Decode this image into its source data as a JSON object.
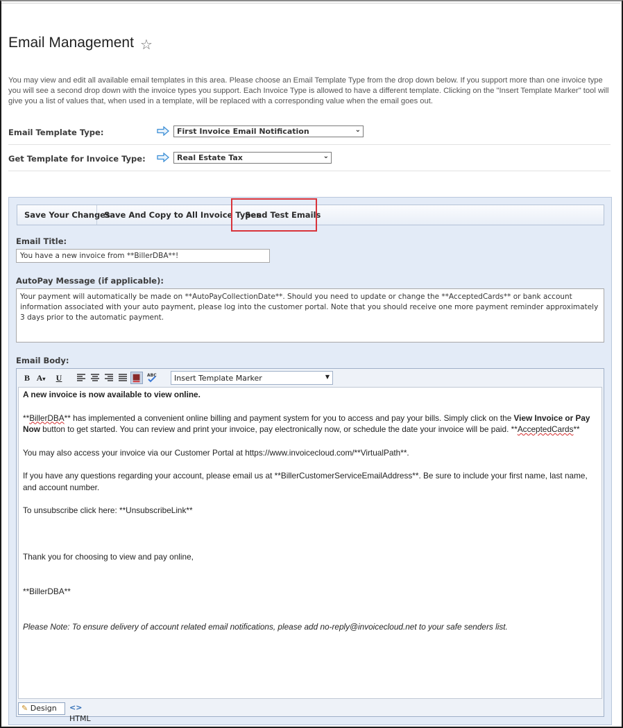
{
  "page": {
    "title": "Email Management",
    "favorite_icon": "star-icon",
    "intro": "You may view and edit all available email templates in this area. Please choose an Email Template Type from the drop down below. If you support more than one invoice type you will see a second drop down with the invoice types you support. Each Invoice Type is allowed to have a different template. Clicking on the \"Insert Template Marker\" tool will give you a list of values that, when used in a template, will be replaced with a corresponding value when the email goes out."
  },
  "fields": {
    "template_type_label": "Email Template Type:",
    "template_type_value": "First Invoice Email Notification",
    "invoice_type_label": "Get Template for Invoice Type:",
    "invoice_type_value": "Real Estate Tax"
  },
  "toolbar": {
    "save_label": "Save Your Changes",
    "save_copy_label": "Save And Copy to All Invoice Types",
    "send_test_label": "Send Test Emails",
    "highlight_color": "#d9333a"
  },
  "form": {
    "email_title_label": "Email Title:",
    "email_title_value": "You have a new invoice from **BillerDBA**!",
    "autopay_label": "AutoPay Message (if applicable):",
    "autopay_value": "Your payment will automatically be made on **AutoPayCollectionDate**. Should you need to update or change the **AcceptedCards** or bank account information associated with your auto payment, please log into the customer portal. Note that you should receive one more payment reminder approximately 3 days prior to the automatic payment.",
    "body_label": "Email Body:"
  },
  "editor": {
    "tools": {
      "bold": "B",
      "font_color": "A",
      "underline": "U"
    },
    "marker_select": "Insert Template Marker",
    "body": {
      "heading": "A new invoice is now available to view online.",
      "p1_a": "**",
      "p1_biller": "BillerDBA",
      "p1_b": "** has implemented a convenient online billing and payment system for you to access and pay your bills. Simply click on the ",
      "p1_bold": "View Invoice or Pay Now",
      "p1_c": " button to get started. You can review and print your invoice, pay electronically now, or schedule the date your invoice will be paid.  **",
      "p1_cards": "AcceptedCards",
      "p1_d": "**",
      "p2": "You may also access your invoice via our Customer Portal at https://www.invoicecloud.com/**VirtualPath**.",
      "p3": "If you have any questions regarding your account, please email us at **BillerCustomerServiceEmailAddress**. Be sure to include your first name, last name, and account number.",
      "p4": "To unsubscribe click here: **UnsubscribeLink**",
      "p5": "Thank you for choosing to view and pay online,",
      "p6": "**BillerDBA**",
      "p7": "Please Note: To ensure delivery of account related email notifications, please add no-reply@invoicecloud.net to your safe senders list."
    },
    "mode_design": "Design",
    "mode_html": "HTML"
  }
}
